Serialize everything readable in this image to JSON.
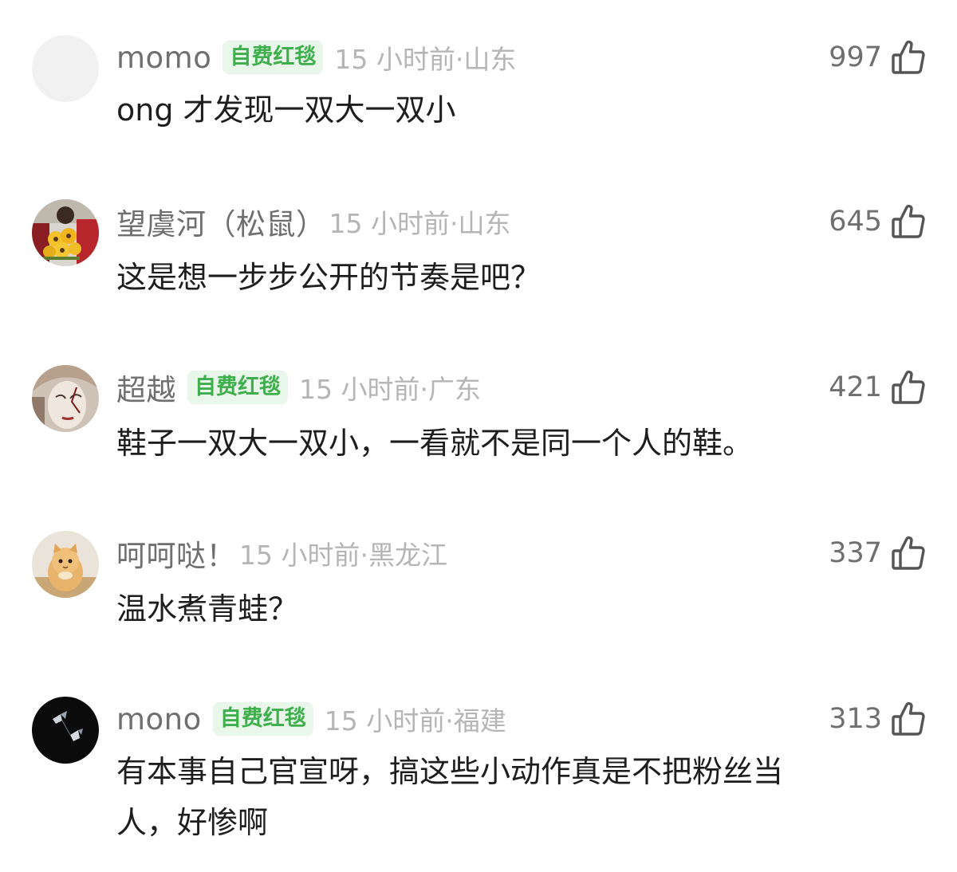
{
  "comments": [
    {
      "username": "momo",
      "badge": "自费红毯",
      "meta": "15 小时前·山东",
      "likes": "997",
      "text": "ong 才发现一双大一双小",
      "avatar": "blank-gray-avatar"
    },
    {
      "username": "望虞河（松鼠）",
      "badge": "",
      "meta": "15 小时前·山东",
      "likes": "645",
      "text": "这是想一步步公开的节奏是吧？",
      "avatar": "person-with-sunflowers-avatar"
    },
    {
      "username": "超越",
      "badge": "自费红毯",
      "meta": "15 小时前·广东",
      "likes": "421",
      "text": "鞋子一双大一双小，一看就不是同一个人的鞋。",
      "avatar": "painted-face-avatar"
    },
    {
      "username": "呵呵哒！",
      "badge": "",
      "meta": "15 小时前·黑龙江",
      "likes": "337",
      "text": "温水煮青蛙？",
      "avatar": "cat-avatar"
    },
    {
      "username": "mono",
      "badge": "自费红毯",
      "meta": "15 小时前·福建",
      "likes": "313",
      "text": "有本事自己官宣呀，搞这些小动作真是不把粉丝当\n人，好惨啊",
      "avatar": "dark-butterfly-avatar"
    }
  ],
  "colors": {
    "username": "#6f6f6f",
    "meta": "#b5b5b5",
    "badge_bg": "#e9f6ea",
    "badge_text": "#3fae4d",
    "body_text": "#1e1e1e"
  },
  "icons": {
    "like": "thumbs-up-icon"
  }
}
